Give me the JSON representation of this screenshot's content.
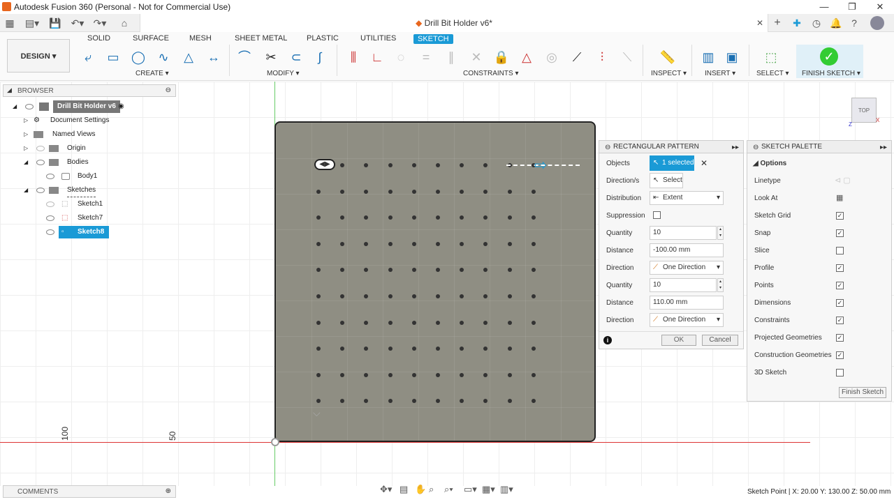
{
  "window": {
    "title": "Autodesk Fusion 360 (Personal - Not for Commercial Use)"
  },
  "doc": {
    "tab_title": "Drill Bit Holder v6*"
  },
  "ribbon": {
    "tabs": [
      "SOLID",
      "SURFACE",
      "MESH",
      "SHEET METAL",
      "PLASTIC",
      "UTILITIES",
      "SKETCH"
    ],
    "active_tab": "SKETCH",
    "design_label": "DESIGN ▾",
    "groups": {
      "create": "CREATE ▾",
      "modify": "MODIFY ▾",
      "constraints": "CONSTRAINTS ▾",
      "inspect": "INSPECT ▾",
      "insert": "INSERT ▾",
      "select": "SELECT ▾",
      "finish": "FINISH SKETCH ▾"
    }
  },
  "browser": {
    "title": "BROWSER",
    "items": [
      {
        "label": "Drill Bit Holder v6"
      },
      {
        "label": "Document Settings"
      },
      {
        "label": "Named Views"
      },
      {
        "label": "Origin"
      },
      {
        "label": "Bodies"
      },
      {
        "label": "Body1"
      },
      {
        "label": "Sketches"
      },
      {
        "label": "Sketch1"
      },
      {
        "label": "Sketch7"
      },
      {
        "label": "Sketch8"
      }
    ]
  },
  "canvas": {
    "axis_label_100": "100",
    "axis_label_50": "50"
  },
  "viewcube": {
    "label": "TOP",
    "x": "X",
    "z": "Z"
  },
  "pattern": {
    "title": "RECTANGULAR PATTERN",
    "objects_label": "Objects",
    "objects_value": "1 selected",
    "directions_label": "Direction/s",
    "directions_value": "Select",
    "distribution_label": "Distribution",
    "distribution_value": "Extent",
    "suppression_label": "Suppression",
    "quantity1_label": "Quantity",
    "quantity1_value": "10",
    "distance1_label": "Distance",
    "distance1_value": "-100.00 mm",
    "direction1_label": "Direction",
    "direction1_value": "One Direction",
    "quantity2_label": "Quantity",
    "quantity2_value": "10",
    "distance2_label": "Distance",
    "distance2_value": "110.00 mm",
    "direction2_label": "Direction",
    "direction2_value": "One Direction",
    "ok_label": "OK",
    "cancel_label": "Cancel"
  },
  "palette": {
    "title": "SKETCH PALETTE",
    "options_label": "Options",
    "linetype": "Linetype",
    "lookat": "Look At",
    "options": [
      {
        "label": "Sketch Grid",
        "checked": true
      },
      {
        "label": "Snap",
        "checked": true
      },
      {
        "label": "Slice",
        "checked": false
      },
      {
        "label": "Profile",
        "checked": true
      },
      {
        "label": "Points",
        "checked": true
      },
      {
        "label": "Dimensions",
        "checked": true
      },
      {
        "label": "Constraints",
        "checked": true
      },
      {
        "label": "Projected Geometries",
        "checked": true
      },
      {
        "label": "Construction Geometries",
        "checked": true
      },
      {
        "label": "3D Sketch",
        "checked": false
      }
    ],
    "finish_label": "Finish Sketch"
  },
  "comments": {
    "title": "COMMENTS"
  },
  "status": {
    "text": "Sketch Point | X: 20.00 Y: 130.00 Z: 50.00 mm"
  }
}
